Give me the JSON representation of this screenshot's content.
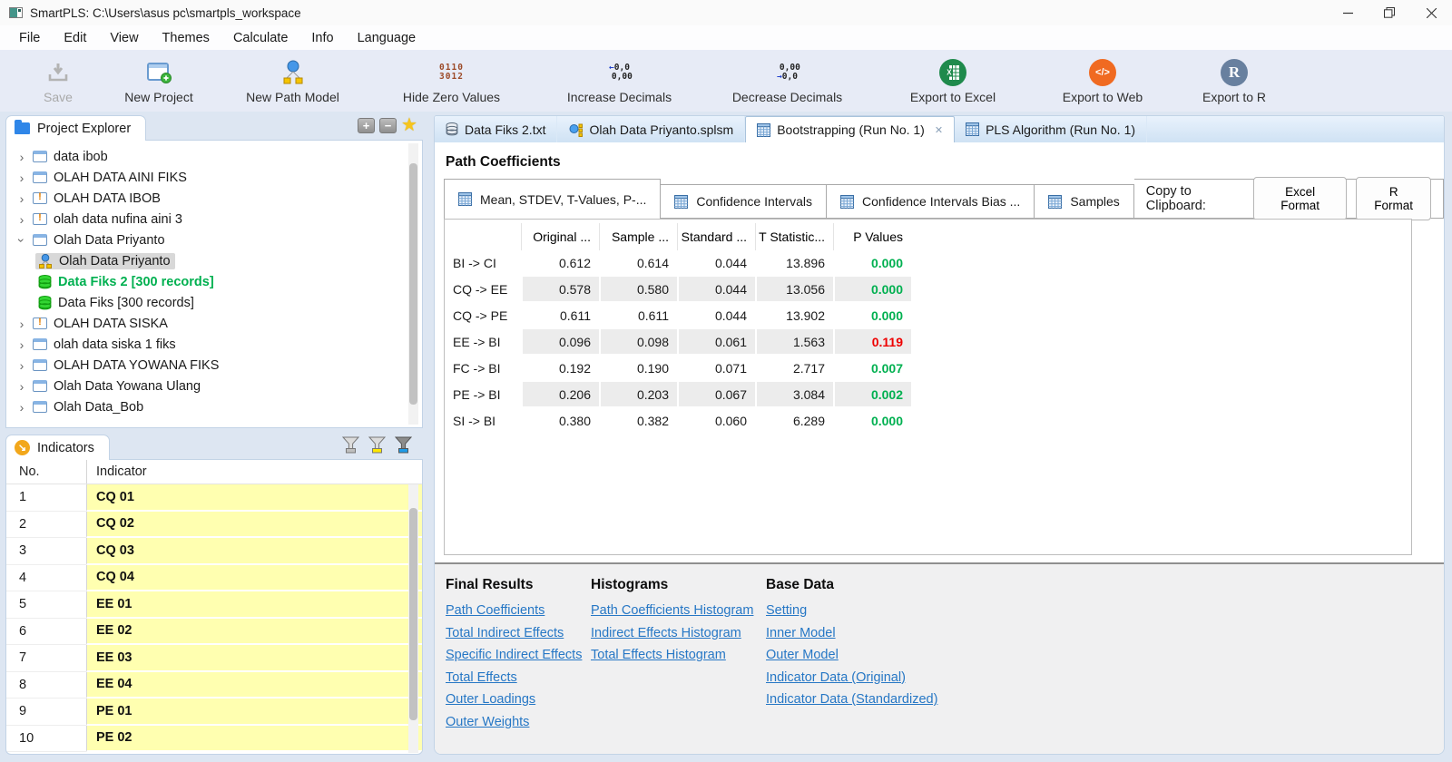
{
  "window": {
    "title": "SmartPLS: C:\\Users\\asus pc\\smartpls_workspace"
  },
  "menu": {
    "items": [
      "File",
      "Edit",
      "View",
      "Themes",
      "Calculate",
      "Info",
      "Language"
    ]
  },
  "toolbar": {
    "save": "Save",
    "new_project": "New Project",
    "new_path_model": "New Path Model",
    "hide_zero": "Hide Zero Values",
    "increase_decimals": "Increase Decimals",
    "decrease_decimals": "Decrease Decimals",
    "export_excel": "Export to Excel",
    "export_web": "Export to Web",
    "export_r": "Export to R"
  },
  "project_explorer": {
    "title": "Project Explorer",
    "items": [
      {
        "label": "data ibob"
      },
      {
        "label": "OLAH DATA AINI FIKS"
      },
      {
        "label": "OLAH DATA IBOB"
      },
      {
        "label": "olah data nufina aini 3"
      },
      {
        "label": "Olah Data Priyanto"
      },
      {
        "label": "Olah Data Priyanto"
      },
      {
        "label": "Data Fiks 2 [300 records]"
      },
      {
        "label": "Data Fiks [300 records]"
      },
      {
        "label": "OLAH DATA SISKA"
      },
      {
        "label": "olah data siska 1 fiks"
      },
      {
        "label": "OLAH DATA YOWANA FIKS"
      },
      {
        "label": "Olah Data Yowana Ulang"
      },
      {
        "label": "Olah Data_Bob"
      }
    ]
  },
  "indicators": {
    "title": "Indicators",
    "col_no": "No.",
    "col_indicator": "Indicator",
    "rows": [
      {
        "no": "1",
        "name": "CQ 01"
      },
      {
        "no": "2",
        "name": "CQ 02"
      },
      {
        "no": "3",
        "name": "CQ 03"
      },
      {
        "no": "4",
        "name": "CQ 04"
      },
      {
        "no": "5",
        "name": "EE 01"
      },
      {
        "no": "6",
        "name": "EE 02"
      },
      {
        "no": "7",
        "name": "EE 03"
      },
      {
        "no": "8",
        "name": "EE 04"
      },
      {
        "no": "9",
        "name": "PE 01"
      },
      {
        "no": "10",
        "name": "PE 02"
      }
    ]
  },
  "tabs": {
    "t0": "Data Fiks 2.txt",
    "t1": "Olah Data Priyanto.splsm",
    "t2": "Bootstrapping (Run No. 1)",
    "t3": "PLS Algorithm (Run No. 1)"
  },
  "results": {
    "heading": "Path Coefficients",
    "subtabs": [
      "Mean, STDEV, T-Values, P-...",
      "Confidence Intervals",
      "Confidence Intervals Bias ...",
      "Samples"
    ],
    "copy_label": "Copy to Clipboard:",
    "btn_excel": "Excel Format",
    "btn_r": "R Format"
  },
  "chart_data": {
    "type": "table",
    "title": "Path Coefficients - Mean, STDEV, T-Values, P-Values",
    "columns": [
      "",
      "Original ...",
      "Sample ...",
      "Standard ...",
      "T Statistic...",
      "P Values"
    ],
    "rows": [
      {
        "label": "BI -> CI",
        "original": "0.612",
        "sample": "0.614",
        "stdev": "0.044",
        "t": "13.896",
        "p": "0.000",
        "p_status": "significant"
      },
      {
        "label": "CQ -> EE",
        "original": "0.578",
        "sample": "0.580",
        "stdev": "0.044",
        "t": "13.056",
        "p": "0.000",
        "p_status": "significant"
      },
      {
        "label": "CQ -> PE",
        "original": "0.611",
        "sample": "0.611",
        "stdev": "0.044",
        "t": "13.902",
        "p": "0.000",
        "p_status": "significant"
      },
      {
        "label": "EE -> BI",
        "original": "0.096",
        "sample": "0.098",
        "stdev": "0.061",
        "t": "1.563",
        "p": "0.119",
        "p_status": "not significant"
      },
      {
        "label": "FC -> BI",
        "original": "0.192",
        "sample": "0.190",
        "stdev": "0.071",
        "t": "2.717",
        "p": "0.007",
        "p_status": "significant"
      },
      {
        "label": "PE -> BI",
        "original": "0.206",
        "sample": "0.203",
        "stdev": "0.067",
        "t": "3.084",
        "p": "0.002",
        "p_status": "significant"
      },
      {
        "label": "SI -> BI",
        "original": "0.380",
        "sample": "0.382",
        "stdev": "0.060",
        "t": "6.289",
        "p": "0.000",
        "p_status": "significant"
      }
    ],
    "colors": {
      "significant": "#00b050",
      "not_significant": "#ee0000"
    }
  },
  "links": {
    "final_title": "Final Results",
    "final": [
      "Path Coefficients",
      "Total Indirect Effects",
      "Specific Indirect Effects",
      "Total Effects",
      "Outer Loadings",
      "Outer Weights"
    ],
    "hist_title": "Histograms",
    "hist": [
      "Path Coefficients Histogram",
      "Indirect Effects Histogram",
      "Total Effects Histogram"
    ],
    "base_title": "Base Data",
    "base": [
      "Setting",
      "Inner Model",
      "Outer Model",
      "Indicator Data (Original)",
      "Indicator Data (Standardized)"
    ]
  }
}
